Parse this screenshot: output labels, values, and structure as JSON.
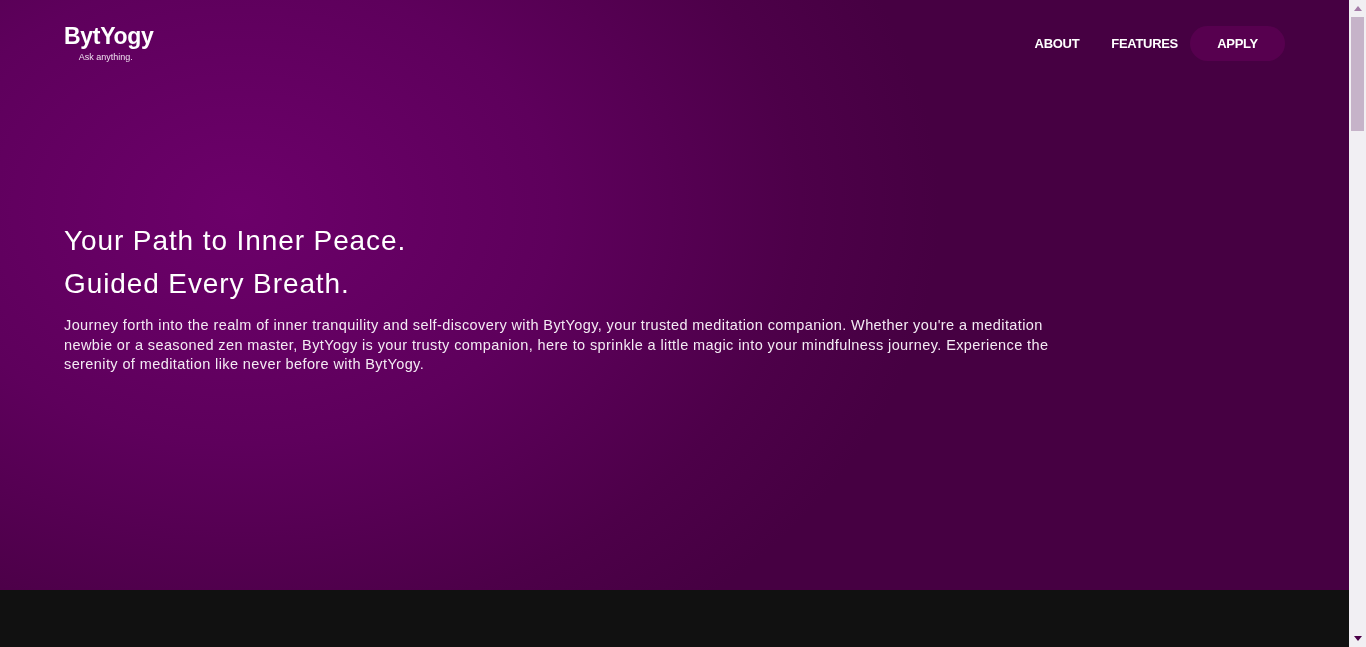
{
  "logo": {
    "name": "BytYogy",
    "tagline": "Ask anything."
  },
  "nav": {
    "items": [
      {
        "label": "ABOUT",
        "kind": "link"
      },
      {
        "label": "FEATURES",
        "kind": "link"
      },
      {
        "label": "APPLY",
        "kind": "button"
      }
    ]
  },
  "hero": {
    "headline": [
      "Your Path to Inner Peace.",
      "Guided Every Breath."
    ],
    "text": "Journey forth into the realm of inner tranquility and self-discovery with BytYogy, your trusted meditation companion. Whether you're a meditation newbie or a seasoned zen master, BytYogy is your trusty companion, here to sprinkle a little magic into your mindfulness journey. Experience the serenity of meditation like never before with BytYogy."
  }
}
